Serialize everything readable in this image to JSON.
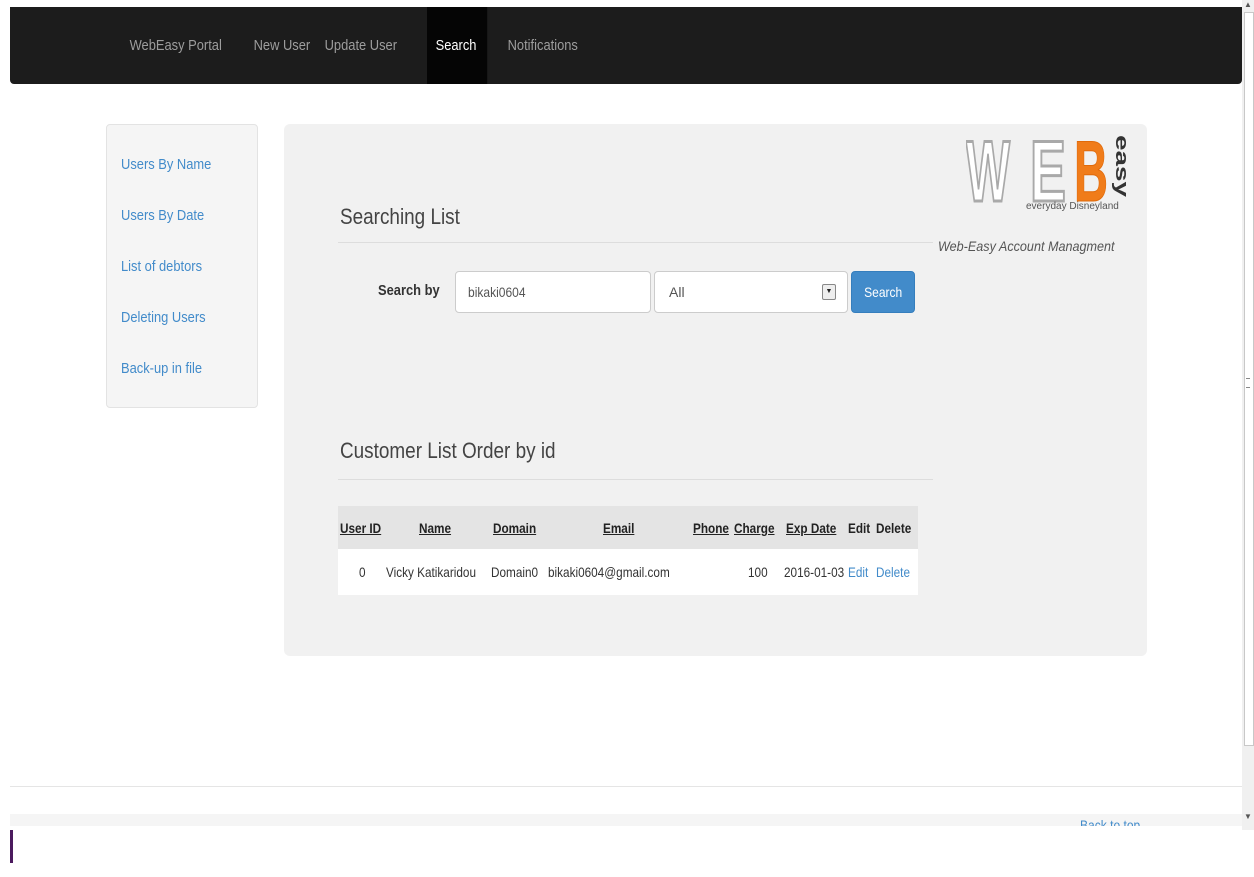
{
  "navbar": {
    "brand": "WebEasy Portal",
    "items": [
      "New User",
      "Update User",
      "Search",
      "Notifications"
    ],
    "active": "Search"
  },
  "sidebar": {
    "items": [
      "Users By Name",
      "Users By Date",
      "List of debtors",
      "Deleting Users",
      "Back-up in file"
    ]
  },
  "logo": {
    "letters": [
      "W",
      "E",
      "B"
    ],
    "vertical_text": "easy",
    "tagline": "everyday Disneyland",
    "caption": "Web-Easy Account Managment",
    "accent_color": "#f07c1a"
  },
  "search": {
    "title": "Searching List",
    "label": "Search by",
    "input_value": "bikaki0604",
    "select_value": "All",
    "button_label": "Search",
    "button_color": "#428bca"
  },
  "customers": {
    "title": "Customer List Order by id",
    "columns": [
      "User ID",
      "Name",
      "Domain",
      "Email",
      "Phone",
      "Charge",
      "Exp Date",
      "Edit",
      "Delete"
    ],
    "rows": [
      {
        "user_id": "0",
        "name": "Vicky Katikaridou",
        "domain": "Domain0",
        "email": "bikaki0604@gmail.com",
        "phone": "",
        "charge": "100",
        "exp_date": "2016-01-03",
        "edit": "Edit",
        "delete": "Delete"
      }
    ]
  },
  "footer": {
    "back_to_top": "Back to top"
  },
  "colors": {
    "navbar_bg": "#1c1c1c",
    "link": "#428bca",
    "panel_bg": "#f1f1f1"
  }
}
